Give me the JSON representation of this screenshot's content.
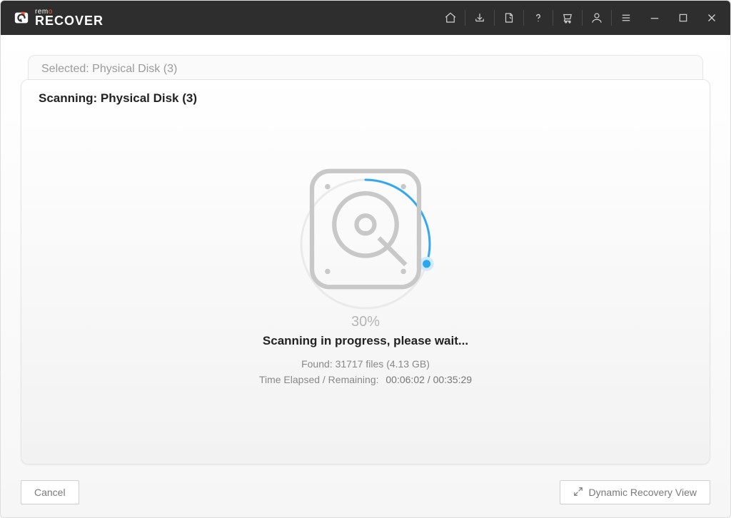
{
  "brand": {
    "top_pre": "rem",
    "top_accent": "o",
    "main": "RECOVER"
  },
  "card_back": {
    "label": "Selected: Physical Disk (3)"
  },
  "scan": {
    "title": "Scanning: Physical Disk (3)",
    "percent_label": "30%",
    "percent_value": 30,
    "status": "Scanning in progress, please wait...",
    "found_label": "Found:",
    "found_files": "31717 files",
    "found_size": "(4.13 GB)",
    "time_label": "Time Elapsed / Remaining:",
    "time_elapsed": "00:06:02",
    "time_remaining": "00:35:29"
  },
  "footer": {
    "cancel": "Cancel",
    "dynamic": "Dynamic Recovery View"
  }
}
